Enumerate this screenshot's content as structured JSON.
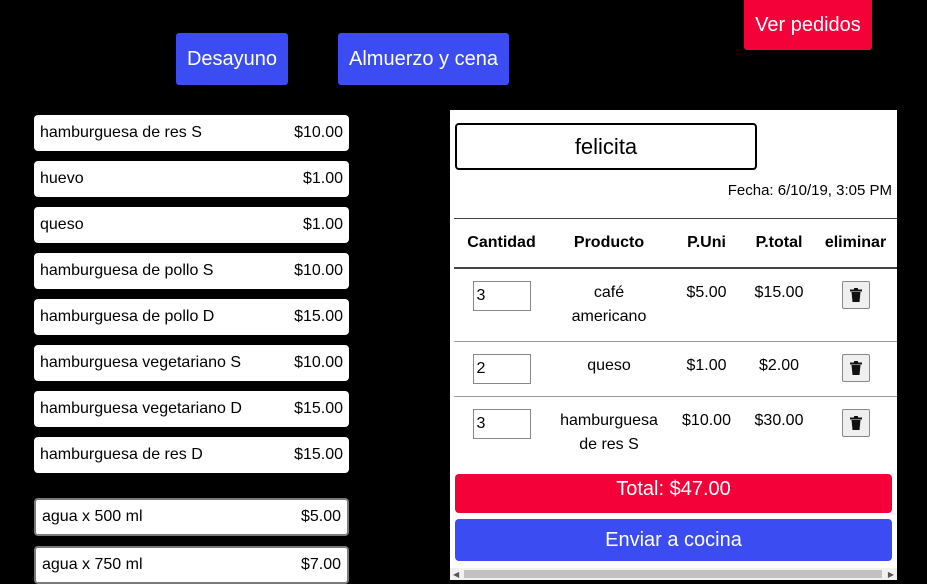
{
  "header": {
    "ver_pedidos": "Ver pedidos",
    "tab_desayuno": "Desayuno",
    "tab_almuerzo": "Almuerzo y cena"
  },
  "menu": [
    {
      "name": "hamburguesa de res S",
      "price": "$10.00"
    },
    {
      "name": "huevo",
      "price": "$1.00"
    },
    {
      "name": "queso",
      "price": "$1.00"
    },
    {
      "name": "hamburguesa de pollo S",
      "price": "$10.00"
    },
    {
      "name": "hamburguesa de pollo D",
      "price": "$15.00"
    },
    {
      "name": "hamburguesa vegetariano S",
      "price": "$10.00"
    },
    {
      "name": "hamburguesa vegetariano D",
      "price": "$15.00"
    },
    {
      "name": "hamburguesa de res D",
      "price": "$15.00"
    },
    {
      "name": "agua x 500 ml",
      "price": "$5.00"
    },
    {
      "name": "agua x 750 ml",
      "price": "$7.00"
    }
  ],
  "order": {
    "client_name": "felicita",
    "fecha": "Fecha: 6/10/19, 3:05 PM",
    "columns": {
      "cantidad": "Cantidad",
      "producto": "Producto",
      "puni": "P.Uni",
      "ptotal": "P.total",
      "eliminar": "eliminar"
    },
    "rows": [
      {
        "qty": "3",
        "product_line1": "café",
        "product_line2": "americano",
        "unit": "$5.00",
        "total": "$15.00"
      },
      {
        "qty": "2",
        "product_line1": "queso",
        "product_line2": "",
        "unit": "$1.00",
        "total": "$2.00"
      },
      {
        "qty": "3",
        "product_line1": "hamburguesa",
        "product_line2": "de res S",
        "unit": "$10.00",
        "total": "$30.00"
      }
    ],
    "total": "Total: $47.00",
    "enviar": "Enviar a cocina"
  },
  "colors": {
    "accent_blue": "#3a4cf2",
    "accent_red": "#f5013a"
  },
  "icons": {
    "delete": "trash-icon"
  }
}
